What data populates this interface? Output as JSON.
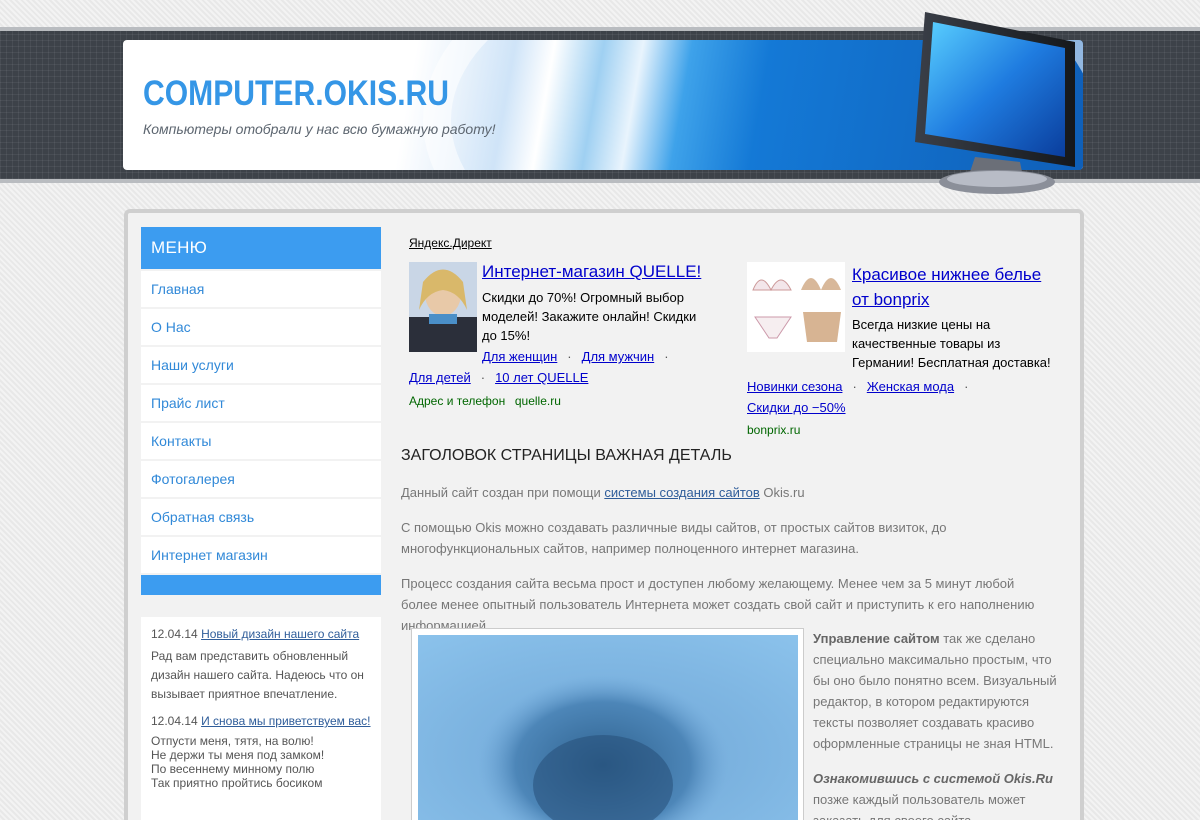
{
  "header": {
    "title": "COMPUTER.OKIS.RU",
    "slogan": "Компьютеры отобрали у нас всю бумажную работу!"
  },
  "menu": {
    "heading": "МЕНЮ",
    "items": [
      {
        "label": "Главная"
      },
      {
        "label": "О Нас"
      },
      {
        "label": "Наши услуги"
      },
      {
        "label": "Прайс лист"
      },
      {
        "label": "Контакты"
      },
      {
        "label": "Фотогалерея"
      },
      {
        "label": "Обратная связь"
      },
      {
        "label": "Интернет магазин"
      }
    ]
  },
  "news": [
    {
      "date": "12.04.14",
      "title": "Новый дизайн нашего сайта",
      "text": "Рад вам представить обновленный дизайн нашего сайта. Надеюсь что он вызывает приятное впечатление."
    },
    {
      "date": "12.04.14",
      "title": "И снова мы приветствуем вас!",
      "lines": [
        "Отпусти меня, тятя, на волю!",
        "Не держи ты меня под замком!",
        "По весеннему минному полю",
        "Так приятно пройтись босиком"
      ]
    }
  ],
  "direct": {
    "label": "Яндекс.Директ",
    "ads": [
      {
        "title": "Интернет-магазин QUELLE!",
        "text": "Скидки до 70%! Огромный выбор моделей! Закажите онлайн! Скидки до 15%!",
        "links": [
          "Для женщин",
          "Для мужчин",
          "Для детей",
          "10 лет QUELLE"
        ],
        "extra": "Адрес и телефон",
        "domain": "quelle.ru"
      },
      {
        "title": "Красивое нижнее белье от bonprix",
        "text": "Всегда низкие цены на качественные товары из Германии! Бесплатная доставка!",
        "links": [
          "Новинки сезона",
          "Женская мода",
          "Скидки до −50%"
        ],
        "domain": "bonprix.ru"
      }
    ]
  },
  "content": {
    "heading": "ЗАГОЛОВОК СТРАНИЦЫ ВАЖНАЯ ДЕТАЛЬ",
    "p1_before": "Данный сайт создан при помощи ",
    "p1_link": "системы создания сайтов",
    "p1_after": " Okis.ru",
    "p2": "С помощью Okis можно создавать различные виды сайтов, от простых сайтов визиток, до многофункциональных сайтов, например полноценного интернет магазина.",
    "p3": "Процесс создания сайта весьма прост и доступен любому желающему. Менее чем за 5 минут любой более менее опытный пользователь Интернета может создать свой сайт и приступить к его наполнению информацией.",
    "side_bold": "Управление сайтом",
    "side_text": " так же сделано специально максимально простым, что бы оно было понятно всем. Визуальный редактор, в котором редактируются тексты позволяет создавать красиво оформленные страницы не зная HTML.",
    "side2_italic": "Ознакомившись с системой Okis.Ru",
    "side2_text": " позже каждый пользователь может заказать для своего сайта дополнительные услуги"
  }
}
